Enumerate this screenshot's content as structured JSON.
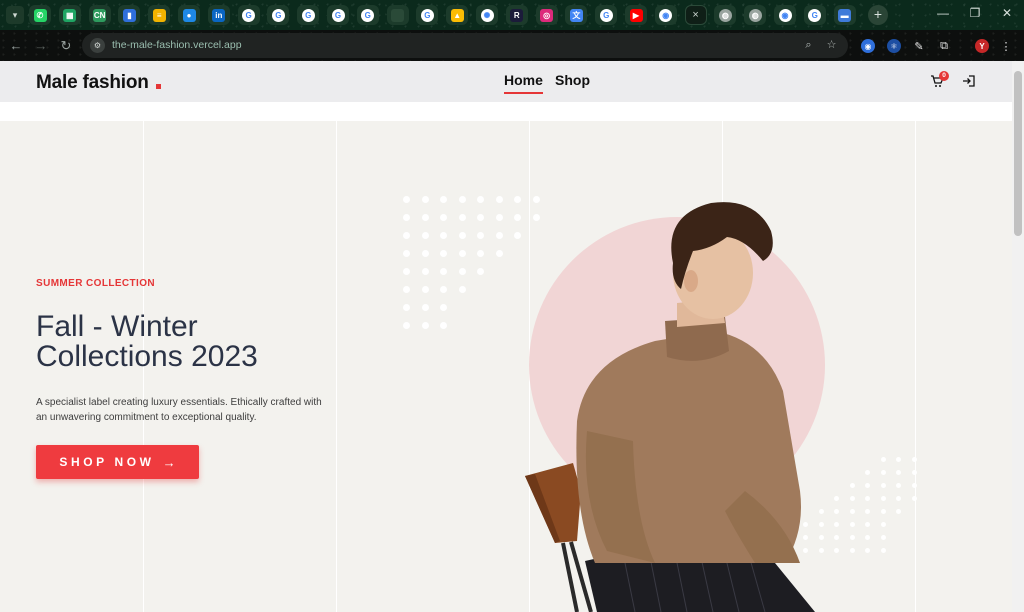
{
  "browser": {
    "url": "the-male-fashion.vercel.app",
    "profile_initial": "Y",
    "tabs": [
      {
        "icon": "whatsapp-icon",
        "color": "#25d366",
        "glyph": "✆"
      },
      {
        "icon": "sheets-icon",
        "color": "#1fa463",
        "glyph": "▦"
      },
      {
        "icon": "coding-ninjas-icon",
        "color": "#2e9b5e",
        "glyph": "CN"
      },
      {
        "icon": "bookmark-app-icon",
        "color": "#2f6fdb",
        "glyph": "▮"
      },
      {
        "icon": "notes-icon",
        "color": "#f2b300",
        "glyph": "≡"
      },
      {
        "icon": "app-icon",
        "color": "#1e88e5",
        "glyph": "●"
      },
      {
        "icon": "linkedin-icon",
        "color": "#0a66c2",
        "glyph": "in"
      },
      {
        "icon": "google-icon",
        "color": "#ffffff",
        "glyph": "G"
      },
      {
        "icon": "google-icon",
        "color": "#ffffff",
        "glyph": "G"
      },
      {
        "icon": "google-icon",
        "color": "#ffffff",
        "glyph": "G"
      },
      {
        "icon": "google-icon",
        "color": "#ffffff",
        "glyph": "G"
      },
      {
        "icon": "google-icon",
        "color": "#ffffff",
        "glyph": "G"
      },
      {
        "icon": "blank-tab-icon",
        "color": "#2a4a38",
        "glyph": ""
      },
      {
        "icon": "google-icon",
        "color": "#ffffff",
        "glyph": "G"
      },
      {
        "icon": "drive-icon",
        "color": "#fbbc04",
        "glyph": "▲"
      },
      {
        "icon": "chatgpt-icon",
        "color": "#ffffff",
        "glyph": "✺"
      },
      {
        "icon": "r-app-icon",
        "color": "#1b1b3a",
        "glyph": "R"
      },
      {
        "icon": "instagram-icon",
        "color": "#dd2a7b",
        "glyph": "◎"
      },
      {
        "icon": "translate-icon",
        "color": "#4285f4",
        "glyph": "文"
      },
      {
        "icon": "google-icon",
        "color": "#ffffff",
        "glyph": "G"
      },
      {
        "icon": "youtube-icon",
        "color": "#ff0000",
        "glyph": "▶"
      },
      {
        "icon": "github-icon",
        "color": "#ffffff",
        "glyph": "◉"
      },
      {
        "icon": "active-tab",
        "color": "#0f1f17",
        "glyph": "×"
      },
      {
        "icon": "globe-icon",
        "color": "#9aa5a0",
        "glyph": "◍"
      },
      {
        "icon": "globe-icon",
        "color": "#9aa5a0",
        "glyph": "◍"
      },
      {
        "icon": "github-icon",
        "color": "#ffffff",
        "glyph": "◉"
      },
      {
        "icon": "google-icon",
        "color": "#ffffff",
        "glyph": "G"
      },
      {
        "icon": "app-bar-icon",
        "color": "#3f7bd9",
        "glyph": "▬"
      }
    ],
    "new_tab_glyph": "+",
    "window": {
      "minimize": "—",
      "restore": "❐",
      "close": "✕"
    }
  },
  "header": {
    "logo": "Male fashion",
    "nav": [
      {
        "label": "Home",
        "active": true
      },
      {
        "label": "Shop",
        "active": false
      }
    ],
    "cart_count": "0"
  },
  "hero": {
    "eyebrow": "SUMMER COLLECTION",
    "headline": "Fall - Winter Collections 2023",
    "description": "A specialist label creating luxury essentials. Ethically crafted with an unwavering commitment to exceptional quality.",
    "cta_label": "SHOP NOW",
    "cta_arrow": "→"
  },
  "colors": {
    "accent": "#e53637",
    "hero_bg": "#f3f2ee",
    "pink": "#f1d5d5",
    "sweater": "#a07a5c"
  }
}
